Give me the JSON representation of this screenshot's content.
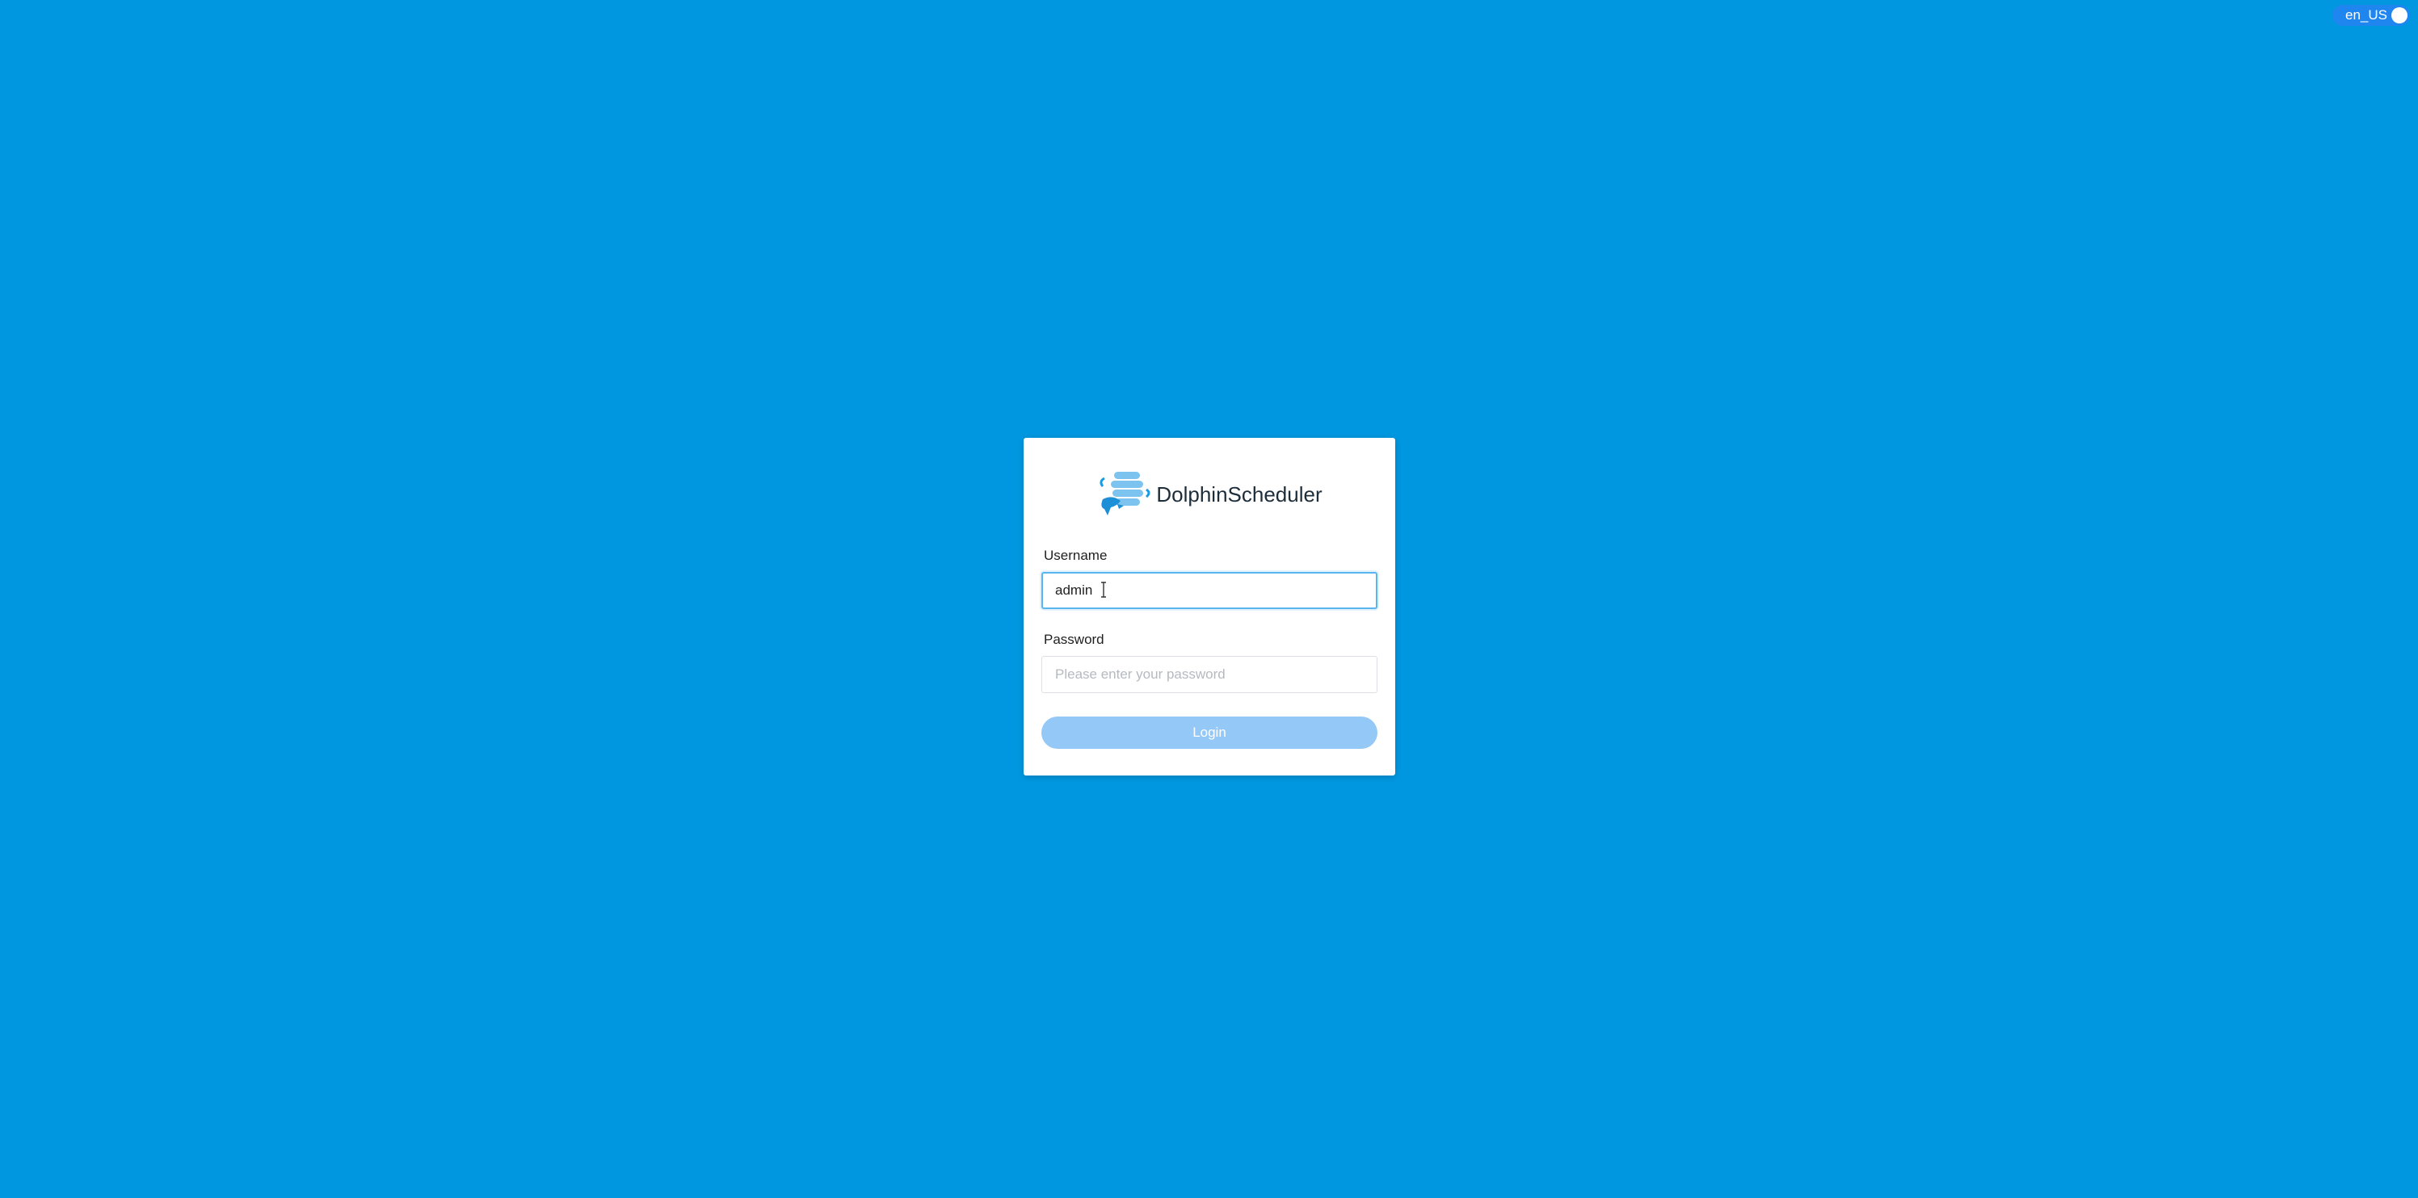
{
  "app": {
    "logo_icon": "dolphin-logo-icon",
    "logo_text": "DolphinScheduler"
  },
  "language_switch": {
    "label": "en_US"
  },
  "login_form": {
    "username_label": "Username",
    "username_value": "admin",
    "password_label": "Password",
    "password_placeholder": "Please enter your password",
    "password_value": "",
    "login_label": "Login"
  },
  "colors": {
    "background": "#0097e0",
    "accent": "#1f86f0",
    "button_disabled": "#94c8f6"
  }
}
